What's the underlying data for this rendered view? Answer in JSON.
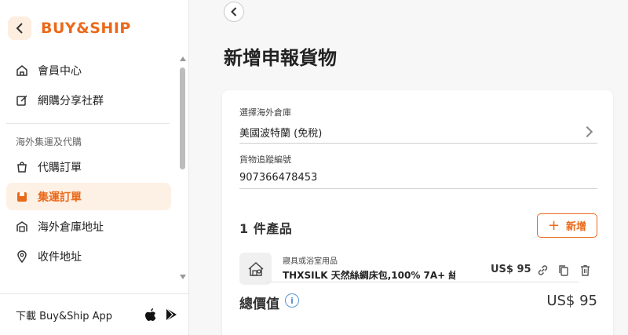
{
  "sidebar": {
    "logo_text": "BUY&SHIP",
    "items": [
      {
        "label": "會員中心"
      },
      {
        "label": "網購分享社群"
      }
    ],
    "section_title": "海外集運及代購",
    "section_items": [
      {
        "label": "代購訂單",
        "active": false
      },
      {
        "label": "集運訂單",
        "active": true
      },
      {
        "label": "海外倉庫地址",
        "active": false
      },
      {
        "label": "收件地址",
        "active": false
      }
    ],
    "footer": {
      "app_label": "下載 Buy&Ship App"
    }
  },
  "main": {
    "title": "新增申報貨物",
    "warehouse": {
      "label": "選擇海外倉庫",
      "value": "美國波特蘭 (免稅)"
    },
    "tracking": {
      "label": "貨物追蹤編號",
      "value": "907366478453"
    },
    "products_title": "1 件產品",
    "add_button": "新增",
    "products": [
      {
        "category": "寢具或浴室用品",
        "name": "THXSILK 天然絲綢床包,100% 7A+ 絲...",
        "price": "US$ 95"
      }
    ],
    "total": {
      "label": "總價值",
      "info": "i",
      "value": "US$ 95"
    }
  },
  "colors": {
    "accent": "#ea6a1b",
    "active_bg": "#fdf0e5",
    "info": "#5b95d6"
  }
}
